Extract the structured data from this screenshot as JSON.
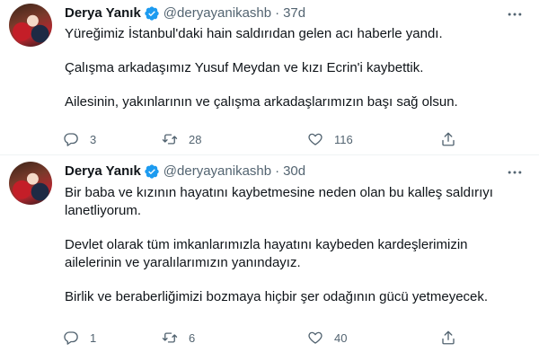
{
  "tweets": [
    {
      "author": {
        "name": "Derya Yanık",
        "handle": "@deryayanikashb"
      },
      "separator": "·",
      "time": "37d",
      "paragraphs": [
        "Yüreğimiz İstanbul'daki hain saldırıdan gelen acı haberle yandı.",
        "Çalışma arkadaşımız Yusuf Meydan ve kızı Ecrin'i kaybettik.",
        "Ailesinin, yakınlarının ve çalışma arkadaşlarımızın başı sağ olsun."
      ],
      "stats": {
        "replies": "3",
        "retweets": "28",
        "likes": "116"
      }
    },
    {
      "author": {
        "name": "Derya Yanık",
        "handle": "@deryayanikashb"
      },
      "separator": "·",
      "time": "30d",
      "paragraphs": [
        "Bir baba ve kızının hayatını kaybetmesine neden olan bu kalleş saldırıyı lanetliyorum.",
        "Devlet olarak tüm imkanlarımızla hayatını kaybeden kardeşlerimizin ailelerinin ve yaralılarımızın yanındayız.",
        "Birlik ve beraberliğimizi bozmaya hiçbir şer odağının gücü yetmeyecek."
      ],
      "stats": {
        "replies": "1",
        "retweets": "6",
        "likes": "40"
      }
    }
  ],
  "icons": {
    "verified": "verified-badge-icon",
    "more": "more-options-icon",
    "reply": "reply-icon",
    "retweet": "retweet-icon",
    "like": "heart-icon",
    "share": "share-icon"
  },
  "colors": {
    "verified_blue": "#1d9bf0",
    "text_primary": "#0f1419",
    "text_secondary": "#536471",
    "divider": "#eff3f4"
  }
}
